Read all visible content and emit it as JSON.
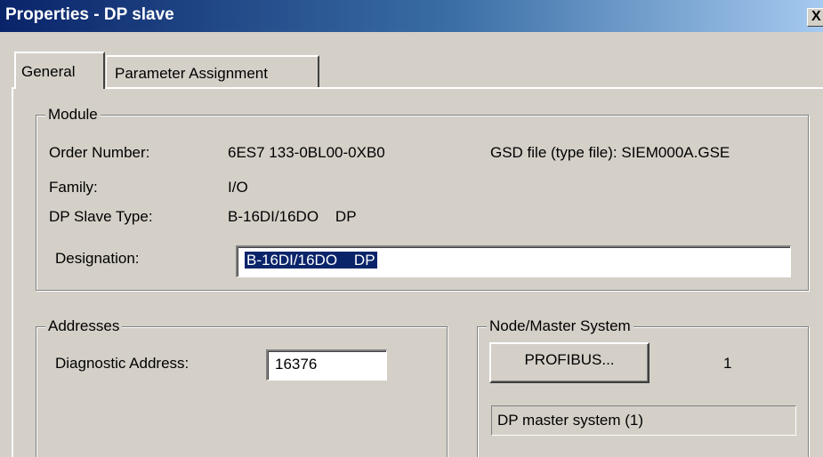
{
  "window": {
    "title": "Properties - DP slave",
    "close_label": "X"
  },
  "tabs": [
    {
      "label": "General",
      "active": true
    },
    {
      "label": "Parameter Assignment",
      "active": false
    }
  ],
  "module": {
    "legend": "Module",
    "order_number_label": "Order Number:",
    "order_number_value": "6ES7 133-0BL00-0XB0",
    "gsd_text": "GSD file (type file): SIEM000A.GSE",
    "family_label": "Family:",
    "family_value": "I/O",
    "slave_type_label": "DP Slave Type:",
    "slave_type_value": "B-16DI/16DO    DP",
    "designation_label": "Designation:",
    "designation_value": "B-16DI/16DO    DP"
  },
  "addresses": {
    "legend": "Addresses",
    "diag_label": "Diagnostic Address:",
    "diag_value": "16376"
  },
  "node": {
    "legend": "Node/Master System",
    "button_label": "PROFIBUS...",
    "node_number": "1",
    "master_system": "DP master system (1)"
  },
  "colors": {
    "titlebar_start": "#0a246a",
    "titlebar_end": "#a6caf0",
    "face": "#d4d0c8",
    "selection": "#0a246a"
  }
}
